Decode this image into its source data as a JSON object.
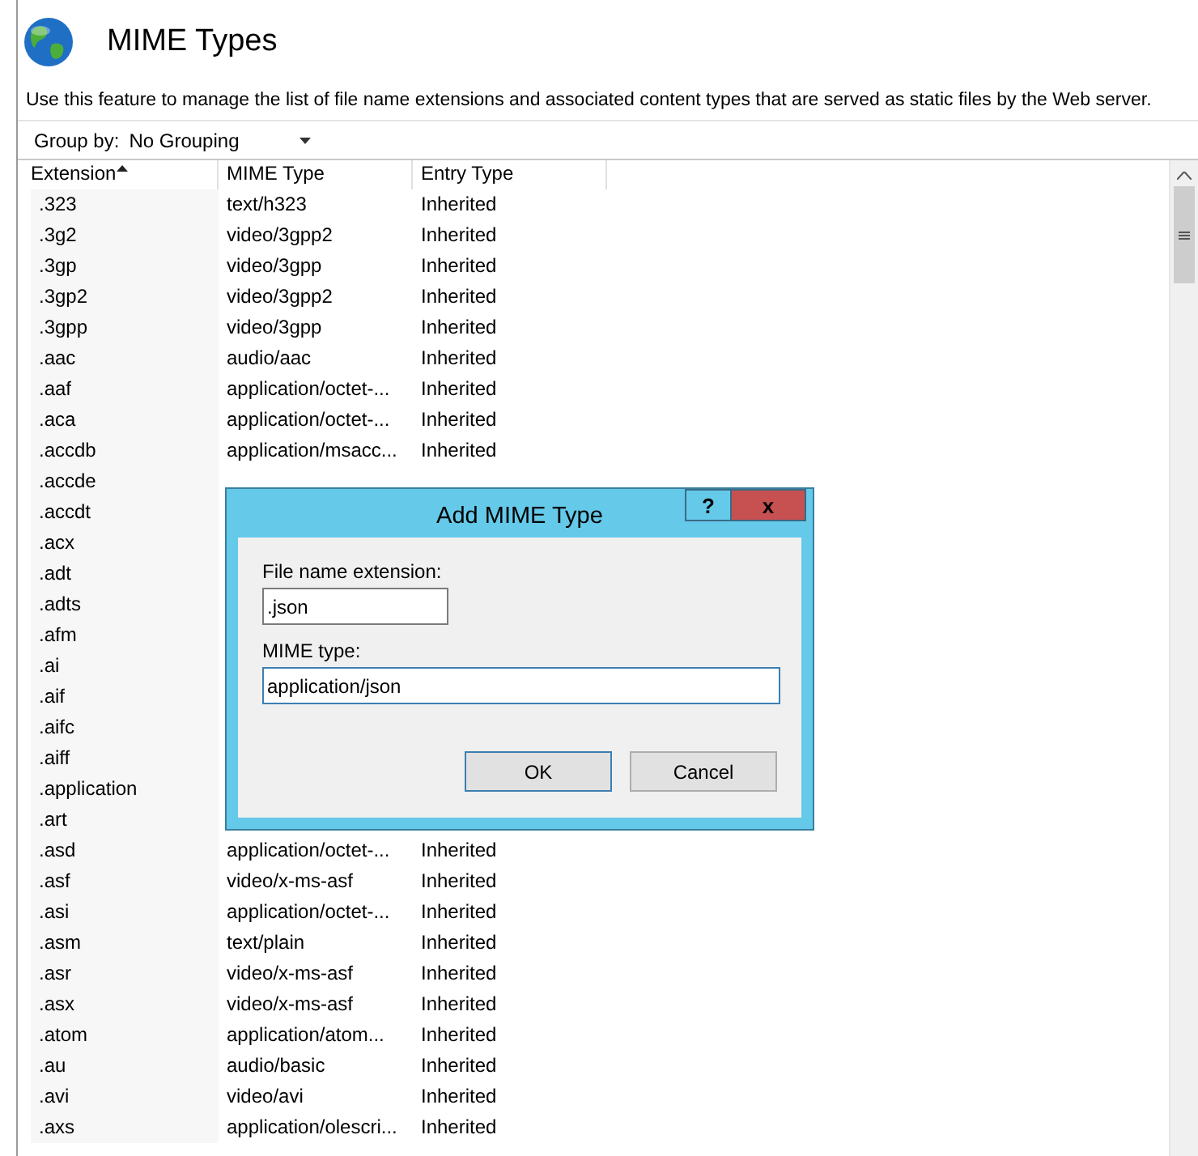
{
  "header": {
    "title": "MIME Types",
    "description": "Use this feature to manage the list of file name extensions and associated content types that are served as static files by the Web server."
  },
  "toolbar": {
    "group_by_label": "Group by:",
    "group_by_value": "No Grouping"
  },
  "table": {
    "columns": [
      {
        "label": "Extension",
        "sorted": true
      },
      {
        "label": "MIME Type",
        "sorted": false
      },
      {
        "label": "Entry Type",
        "sorted": false
      }
    ],
    "rows": [
      {
        "extension": ".323",
        "mime_type": "text/h323",
        "entry_type": "Inherited"
      },
      {
        "extension": ".3g2",
        "mime_type": "video/3gpp2",
        "entry_type": "Inherited"
      },
      {
        "extension": ".3gp",
        "mime_type": "video/3gpp",
        "entry_type": "Inherited"
      },
      {
        "extension": ".3gp2",
        "mime_type": "video/3gpp2",
        "entry_type": "Inherited"
      },
      {
        "extension": ".3gpp",
        "mime_type": "video/3gpp",
        "entry_type": "Inherited"
      },
      {
        "extension": ".aac",
        "mime_type": "audio/aac",
        "entry_type": "Inherited"
      },
      {
        "extension": ".aaf",
        "mime_type": "application/octet-...",
        "entry_type": "Inherited"
      },
      {
        "extension": ".aca",
        "mime_type": "application/octet-...",
        "entry_type": "Inherited"
      },
      {
        "extension": ".accdb",
        "mime_type": "application/msacc...",
        "entry_type": "Inherited"
      },
      {
        "extension": ".accde"
      },
      {
        "extension": ".accdt"
      },
      {
        "extension": ".acx"
      },
      {
        "extension": ".adt"
      },
      {
        "extension": ".adts"
      },
      {
        "extension": ".afm"
      },
      {
        "extension": ".ai"
      },
      {
        "extension": ".aif"
      },
      {
        "extension": ".aifc"
      },
      {
        "extension": ".aiff"
      },
      {
        "extension": ".application"
      },
      {
        "extension": ".art"
      },
      {
        "extension": ".asd",
        "mime_type": "application/octet-...",
        "entry_type": "Inherited"
      },
      {
        "extension": ".asf",
        "mime_type": "video/x-ms-asf",
        "entry_type": "Inherited"
      },
      {
        "extension": ".asi",
        "mime_type": "application/octet-...",
        "entry_type": "Inherited"
      },
      {
        "extension": ".asm",
        "mime_type": "text/plain",
        "entry_type": "Inherited"
      },
      {
        "extension": ".asr",
        "mime_type": "video/x-ms-asf",
        "entry_type": "Inherited"
      },
      {
        "extension": ".asx",
        "mime_type": "video/x-ms-asf",
        "entry_type": "Inherited"
      },
      {
        "extension": ".atom",
        "mime_type": "application/atom...",
        "entry_type": "Inherited"
      },
      {
        "extension": ".au",
        "mime_type": "audio/basic",
        "entry_type": "Inherited"
      },
      {
        "extension": ".avi",
        "mime_type": "video/avi",
        "entry_type": "Inherited"
      },
      {
        "extension": ".axs",
        "mime_type": "application/olescri...",
        "entry_type": "Inherited"
      }
    ]
  },
  "dialog": {
    "title": "Add MIME Type",
    "help_button": "?",
    "close_button": "x",
    "extension_label": "File name extension:",
    "extension_value": ".json",
    "mime_label": "MIME type:",
    "mime_value": "application/json",
    "buttons": [
      {
        "label": "OK",
        "default": true
      },
      {
        "label": "Cancel",
        "default": false
      }
    ]
  }
}
